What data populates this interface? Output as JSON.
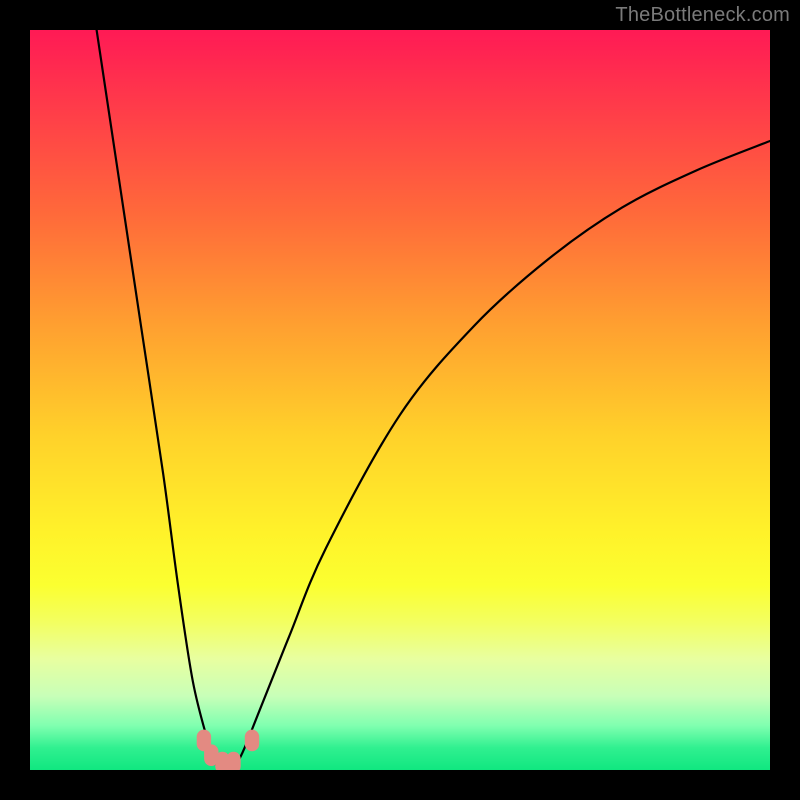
{
  "watermark": "TheBottleneck.com",
  "chart_data": {
    "type": "line",
    "title": "",
    "xlabel": "",
    "ylabel": "",
    "xlim": [
      0,
      100
    ],
    "ylim": [
      0,
      100
    ],
    "background_gradient": {
      "top_color": "#ff1a55",
      "bottom_color": "#10e780",
      "meaning": "redundant bottleneck → optimal"
    },
    "series": [
      {
        "name": "bottleneck-curve",
        "x": [
          9,
          12,
          15,
          18,
          20,
          22,
          24,
          25,
          26,
          27,
          28,
          29,
          31,
          35,
          40,
          50,
          60,
          70,
          80,
          90,
          100
        ],
        "y": [
          100,
          80,
          60,
          40,
          25,
          12,
          4,
          1,
          0,
          0,
          1,
          3,
          8,
          18,
          30,
          48,
          60,
          69,
          76,
          81,
          85
        ]
      }
    ],
    "markers": [
      {
        "name": "config-point",
        "x": 23.5,
        "y": 4
      },
      {
        "name": "config-point",
        "x": 24.5,
        "y": 2
      },
      {
        "name": "config-point",
        "x": 26.0,
        "y": 1
      },
      {
        "name": "config-point",
        "x": 27.5,
        "y": 1
      },
      {
        "name": "config-point",
        "x": 30.0,
        "y": 4
      }
    ],
    "marker_style": {
      "color": "#e38a82",
      "radius_px": 9
    }
  }
}
